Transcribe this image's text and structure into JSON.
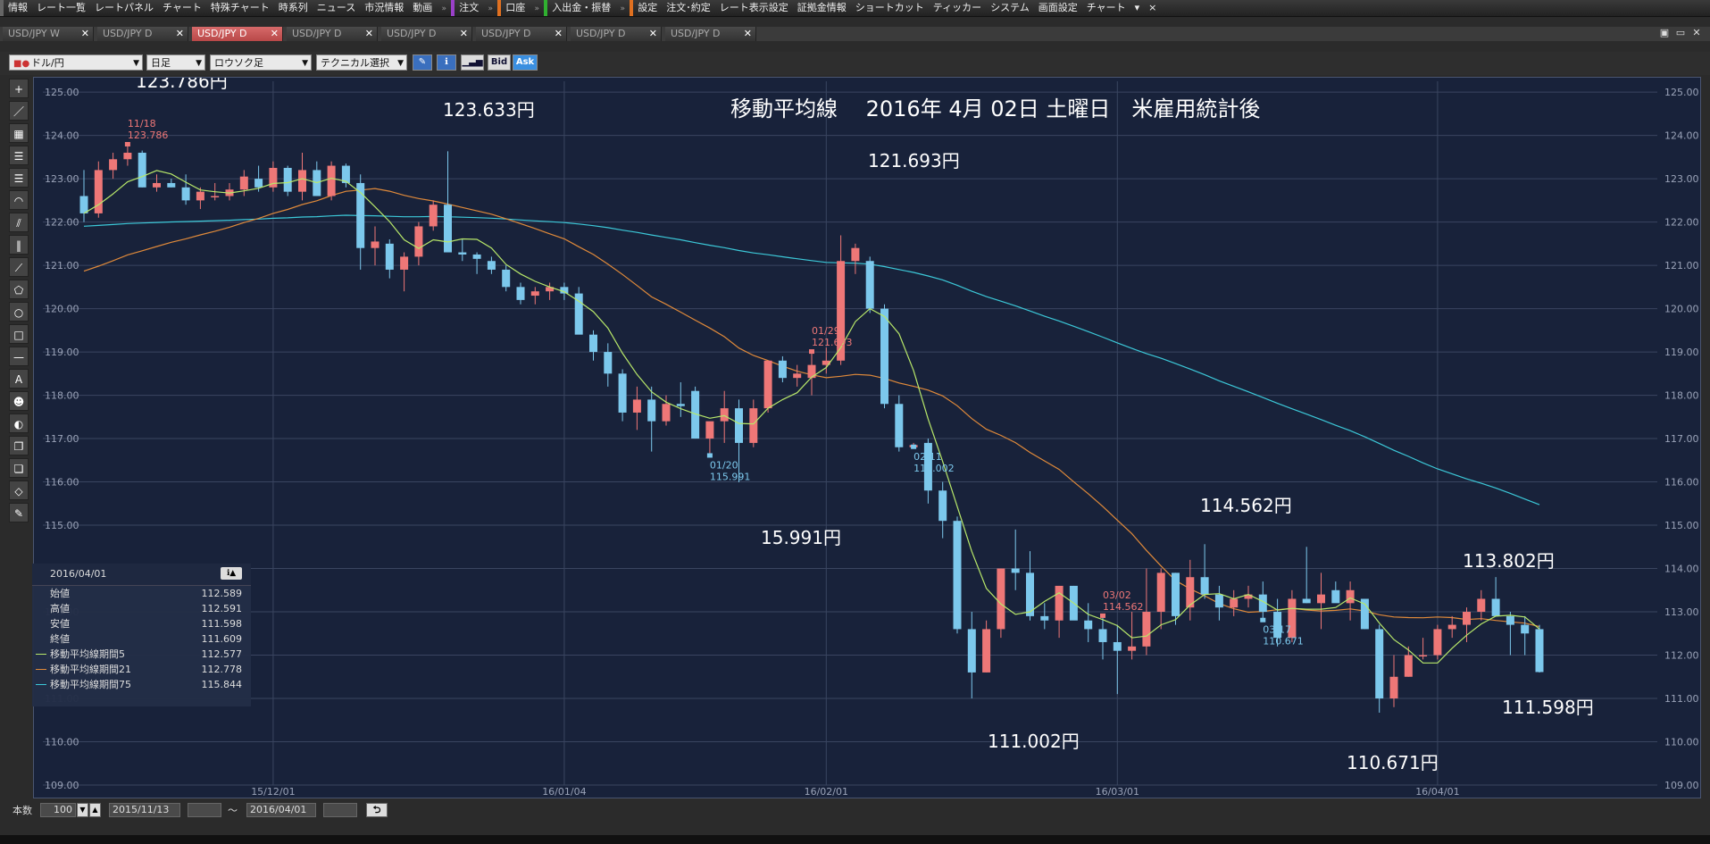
{
  "menu": {
    "items": [
      {
        "label": "情報",
        "bar": "#666"
      },
      {
        "label": "レート一覧"
      },
      {
        "label": "レートパネル"
      },
      {
        "label": "チャート"
      },
      {
        "label": "特殊チャート"
      },
      {
        "label": "時系列"
      },
      {
        "label": "ニュース"
      },
      {
        "label": "市況情報"
      },
      {
        "label": "動画"
      },
      {
        "label": "注文",
        "bar": "#9a40c8"
      },
      {
        "label": "口座",
        "bar": "#e07020"
      },
      {
        "label": "入出金・振替",
        "bar": "#30b030"
      },
      {
        "label": "設定",
        "bar": "#e07020"
      },
      {
        "label": "注文･約定"
      },
      {
        "label": "レート表示設定"
      },
      {
        "label": "証拠金情報"
      },
      {
        "label": "ショートカット"
      },
      {
        "label": "ティッカー"
      },
      {
        "label": "システム"
      },
      {
        "label": "画面設定"
      },
      {
        "label": "チャート"
      }
    ],
    "more_glyph": "▾",
    "close_glyph": "×"
  },
  "tabs": [
    {
      "label": "USD/JPY W",
      "active": false
    },
    {
      "label": "USD/JPY D",
      "active": false
    },
    {
      "label": "USD/JPY D",
      "active": true
    },
    {
      "label": "USD/JPY D",
      "active": false
    },
    {
      "label": "USD/JPY D",
      "active": false
    },
    {
      "label": "USD/JPY D",
      "active": false
    },
    {
      "label": "USD/JPY D",
      "active": false
    },
    {
      "label": "USD/JPY D",
      "active": false
    }
  ],
  "toolbar": {
    "symbol": "ドル/円",
    "period": "日足",
    "chart_type": "ロウソク足",
    "technical": "テクニカル選択",
    "bid": "Bid",
    "ask": "Ask"
  },
  "side_tools": [
    "crosshair-icon",
    "line-icon",
    "ruler-icon",
    "hline-icon",
    "multiline-icon",
    "fan-icon",
    "channel-icon",
    "vlines-icon",
    "pen-icon",
    "pentagon-icon",
    "circle-icon",
    "rect-icon",
    "minus-icon",
    "text-icon",
    "stamp-icon",
    "paint-icon",
    "copy-icon",
    "paste-icon",
    "eraser-icon",
    "settings-icon"
  ],
  "side_tool_glyphs": [
    "+",
    "／",
    "▦",
    "☰",
    "☰",
    "◠",
    "⫽",
    "‖",
    "⟋",
    "⬠",
    "○",
    "□",
    "—",
    "A",
    "☻",
    "◐",
    "❐",
    "❏",
    "◇",
    "✎"
  ],
  "chart": {
    "annotation_title": "移動平均線　 2016年 4月 02日 土曜日　米雇用統計後",
    "price_labels": [
      {
        "text": "123.786円",
        "date_i": 3
      },
      {
        "text": "123.633円",
        "date_i": 24
      },
      {
        "text": "121.693円",
        "date_i": 50
      },
      {
        "text": "15.991円",
        "date_i": 44
      },
      {
        "text": "114.562円",
        "date_i": 76
      },
      {
        "text": "111.002円",
        "date_i": 61
      },
      {
        "text": "113.802円",
        "date_i": 94
      },
      {
        "text": "111.598円",
        "date_i": 97
      },
      {
        "text": "110.671円",
        "date_i": 85
      }
    ],
    "hilo_marks": [
      {
        "date": "11/18",
        "price": "123.786",
        "date_i": 3,
        "kind": "high"
      },
      {
        "date": "01/29",
        "price": "121.693",
        "date_i": 50,
        "kind": "high"
      },
      {
        "date": "01/20",
        "price": "115.991",
        "date_i": 43,
        "kind": "low"
      },
      {
        "date": "02/11",
        "price": "111.002",
        "date_i": 57,
        "kind": "low"
      },
      {
        "date": "03/02",
        "price": "114.562",
        "date_i": 70,
        "kind": "high"
      },
      {
        "date": "03/17",
        "price": "110.671",
        "date_i": 81,
        "kind": "low"
      }
    ],
    "xlabels": [
      {
        "text": "15/12/01",
        "i": 13
      },
      {
        "text": "16/01/04",
        "i": 33
      },
      {
        "text": "16/02/01",
        "i": 51
      },
      {
        "text": "16/03/01",
        "i": 71
      },
      {
        "text": "16/04/01",
        "i": 93
      }
    ],
    "colors": {
      "bg": "#18223a",
      "up": "#ee7777",
      "down": "#7cc8ec",
      "ma5": "#b8e86a",
      "ma21": "#e08a3a",
      "ma75": "#3cc8d8",
      "grid": "#3a4560",
      "axis_text": "#9aa3b8",
      "label": "#ffffff",
      "hilo_up": "#ee7777",
      "hilo_down": "#7cc8ec"
    }
  },
  "chart_data": {
    "type": "candlestick",
    "ylim": [
      109,
      125.25
    ],
    "yticks": [
      "109.00",
      "110.00",
      "111.00",
      "112.00",
      "113.00",
      "114.00",
      "115.00",
      "116.00",
      "117.00",
      "118.00",
      "119.00",
      "120.00",
      "121.00",
      "122.00",
      "123.00",
      "124.00",
      "125.00"
    ],
    "candles": [
      [
        122.6,
        123.2,
        122.0,
        122.2
      ],
      [
        122.2,
        123.4,
        122.1,
        123.2
      ],
      [
        123.2,
        123.6,
        123.0,
        123.45
      ],
      [
        123.45,
        123.786,
        123.3,
        123.6
      ],
      [
        123.6,
        123.65,
        122.8,
        122.8
      ],
      [
        122.8,
        123.1,
        122.7,
        122.9
      ],
      [
        122.9,
        123.0,
        122.8,
        122.8
      ],
      [
        122.8,
        123.1,
        122.4,
        122.5
      ],
      [
        122.5,
        122.8,
        122.3,
        122.7
      ],
      [
        122.6,
        122.9,
        122.5,
        122.6
      ],
      [
        122.6,
        122.9,
        122.5,
        122.75
      ],
      [
        122.75,
        123.2,
        122.6,
        123.05
      ],
      [
        123.0,
        123.3,
        122.7,
        122.8
      ],
      [
        122.8,
        123.4,
        122.7,
        123.25
      ],
      [
        123.25,
        123.3,
        122.6,
        122.7
      ],
      [
        122.7,
        123.6,
        122.5,
        123.2
      ],
      [
        123.2,
        123.4,
        122.6,
        122.6
      ],
      [
        122.6,
        123.4,
        122.5,
        123.3
      ],
      [
        123.3,
        123.35,
        122.8,
        122.9
      ],
      [
        122.9,
        123.1,
        120.9,
        121.4
      ],
      [
        121.4,
        121.9,
        121.0,
        121.55
      ],
      [
        121.5,
        121.6,
        120.7,
        120.9
      ],
      [
        120.9,
        121.3,
        120.4,
        121.2
      ],
      [
        121.2,
        122.0,
        121.0,
        121.9
      ],
      [
        121.9,
        122.5,
        121.8,
        122.4
      ],
      [
        122.4,
        123.633,
        121.8,
        121.3
      ],
      [
        121.3,
        121.6,
        121.1,
        121.25
      ],
      [
        121.25,
        121.3,
        120.8,
        121.15
      ],
      [
        121.1,
        121.2,
        120.8,
        120.9
      ],
      [
        120.9,
        121.0,
        120.4,
        120.5
      ],
      [
        120.5,
        120.6,
        120.1,
        120.2
      ],
      [
        120.3,
        120.5,
        120.1,
        120.4
      ],
      [
        120.4,
        120.6,
        120.2,
        120.5
      ],
      [
        120.5,
        120.6,
        120.2,
        120.35
      ],
      [
        120.35,
        120.5,
        119.6,
        119.4
      ],
      [
        119.4,
        119.5,
        118.8,
        119.0
      ],
      [
        119.0,
        119.2,
        118.2,
        118.5
      ],
      [
        118.5,
        118.6,
        117.4,
        117.6
      ],
      [
        117.6,
        118.2,
        117.2,
        117.9
      ],
      [
        117.9,
        118.2,
        116.7,
        117.4
      ],
      [
        117.4,
        118.0,
        117.3,
        117.8
      ],
      [
        117.8,
        118.3,
        117.5,
        117.75
      ],
      [
        118.1,
        118.2,
        117.0,
        117.0
      ],
      [
        117.0,
        117.3,
        116.6,
        117.4
      ],
      [
        117.4,
        118.1,
        116.9,
        117.7
      ],
      [
        117.7,
        117.9,
        115.991,
        116.9
      ],
      [
        116.9,
        117.9,
        116.8,
        117.7
      ],
      [
        117.7,
        118.8,
        117.6,
        118.8
      ],
      [
        118.8,
        118.9,
        118.3,
        118.4
      ],
      [
        118.4,
        118.7,
        118.2,
        118.5
      ],
      [
        118.4,
        119.0,
        118.0,
        118.7
      ],
      [
        118.7,
        119.1,
        118.5,
        118.8
      ],
      [
        118.8,
        121.693,
        118.7,
        121.1
      ],
      [
        121.1,
        121.5,
        120.8,
        121.4
      ],
      [
        121.1,
        121.2,
        119.9,
        120.0
      ],
      [
        120.0,
        120.1,
        117.7,
        117.8
      ],
      [
        117.8,
        118.0,
        116.7,
        116.8
      ],
      [
        116.8,
        116.9,
        116.8,
        116.85
      ],
      [
        116.9,
        117.0,
        115.5,
        115.8
      ],
      [
        115.8,
        116.0,
        114.7,
        115.1
      ],
      [
        115.1,
        115.2,
        112.5,
        112.6
      ],
      [
        112.6,
        113.0,
        111.002,
        111.6
      ],
      [
        111.6,
        112.8,
        111.6,
        112.6
      ],
      [
        112.6,
        114.0,
        112.4,
        114.0
      ],
      [
        114.0,
        114.9,
        113.5,
        113.9
      ],
      [
        113.9,
        114.4,
        112.8,
        112.9
      ],
      [
        112.9,
        113.2,
        112.6,
        112.8
      ],
      [
        112.8,
        113.6,
        112.4,
        113.6
      ],
      [
        113.6,
        113.6,
        113.0,
        112.8
      ],
      [
        112.8,
        113.2,
        112.3,
        112.6
      ],
      [
        112.6,
        112.9,
        111.9,
        112.3
      ],
      [
        112.3,
        112.7,
        111.1,
        112.1
      ],
      [
        112.1,
        113.0,
        111.9,
        112.2
      ],
      [
        112.2,
        114.0,
        112.0,
        113.0
      ],
      [
        113.0,
        114.0,
        112.6,
        113.9
      ],
      [
        113.9,
        113.9,
        112.7,
        112.9
      ],
      [
        113.1,
        114.2,
        112.8,
        113.8
      ],
      [
        113.8,
        114.562,
        113.3,
        113.4
      ],
      [
        113.4,
        113.6,
        112.8,
        113.1
      ],
      [
        113.1,
        113.5,
        112.9,
        113.3
      ],
      [
        113.3,
        113.6,
        113.1,
        113.4
      ],
      [
        113.4,
        113.7,
        112.8,
        113.0
      ],
      [
        113.0,
        113.3,
        112.2,
        112.4
      ],
      [
        112.4,
        113.5,
        112.3,
        113.3
      ],
      [
        113.3,
        114.5,
        113.2,
        113.2
      ],
      [
        113.2,
        113.9,
        112.6,
        113.4
      ],
      [
        113.5,
        113.7,
        113.3,
        113.2
      ],
      [
        113.2,
        113.7,
        112.8,
        113.5
      ],
      [
        113.3,
        113.3,
        112.6,
        112.6
      ],
      [
        112.6,
        112.7,
        110.671,
        111.0
      ],
      [
        111.0,
        112.0,
        110.8,
        111.5
      ],
      [
        111.5,
        112.2,
        111.5,
        112.0
      ],
      [
        112.0,
        112.4,
        111.9,
        112.0
      ],
      [
        112.0,
        112.7,
        111.9,
        112.6
      ],
      [
        112.6,
        112.9,
        112.4,
        112.7
      ],
      [
        112.7,
        113.1,
        112.3,
        113.0
      ],
      [
        113.0,
        113.5,
        112.8,
        113.3
      ],
      [
        113.3,
        113.802,
        112.9,
        112.9
      ],
      [
        112.9,
        113.0,
        112.0,
        112.7
      ],
      [
        112.7,
        112.9,
        112.0,
        112.5
      ],
      [
        112.6,
        112.7,
        111.598,
        111.609
      ]
    ],
    "series": [
      {
        "name": "移動平均線期間5",
        "value": "112.577"
      },
      {
        "name": "移動平均線期間21",
        "value": "112.778"
      },
      {
        "name": "移動平均線期間75",
        "value": "115.844"
      }
    ]
  },
  "info_panel": {
    "date": "2016/04/01",
    "rows": [
      {
        "label": "始値",
        "value": "112.589"
      },
      {
        "label": "高値",
        "value": "112.591"
      },
      {
        "label": "安値",
        "value": "111.598"
      },
      {
        "label": "終値",
        "value": "111.609"
      }
    ]
  },
  "bottom": {
    "count_label": "本数",
    "count_value": "100",
    "from_date": "2015/11/13",
    "tilde": "〜",
    "to_date": "2016/04/01",
    "reset_glyph": "⮌"
  }
}
